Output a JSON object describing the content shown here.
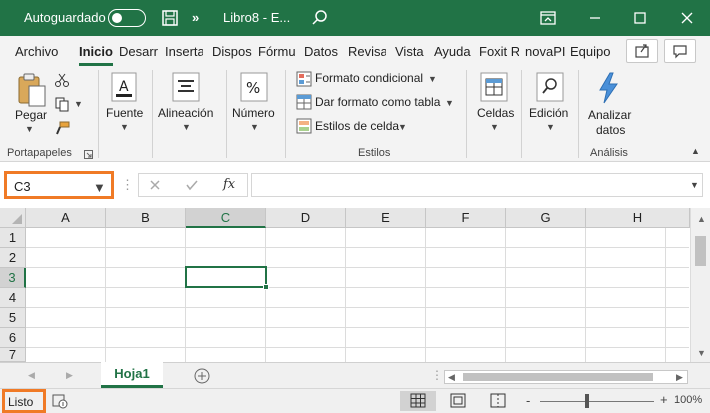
{
  "title_bar": {
    "autosave_label": "Autoguardado",
    "autosave_state": "off",
    "filename": "Libro8 - E...",
    "more_symbol": "»"
  },
  "ribbon_tabs": [
    "Archivo",
    "Inicio",
    "Desarr",
    "Insertar",
    "Dispos",
    "Fórmu",
    "Datos",
    "Revisar",
    "Vista",
    "Ayuda",
    "Foxit R",
    "novaPI",
    "Equipo"
  ],
  "active_tab": "Inicio",
  "ribbon": {
    "paste_label": "Pegar",
    "clipboard_group": "Portapapeles",
    "font_label": "Fuente",
    "align_label": "Alineación",
    "number_label": "Número",
    "conditional_format": "Formato condicional",
    "format_table": "Dar formato como tabla",
    "cell_styles": "Estilos de celda",
    "styles_group": "Estilos",
    "cells_label": "Celdas",
    "edit_label": "Edición",
    "analyze_label_1": "Analizar",
    "analyze_label_2": "datos",
    "analysis_group": "Análisis"
  },
  "formula_bar": {
    "name_box": "C3",
    "fx": "fx",
    "formula_value": ""
  },
  "grid": {
    "columns": [
      "A",
      "B",
      "C",
      "D",
      "E",
      "F",
      "G",
      "H"
    ],
    "rows": [
      "1",
      "2",
      "3",
      "4",
      "5",
      "6",
      "7"
    ],
    "active_column": "C",
    "active_row": "3"
  },
  "sheets": {
    "active": "Hoja1",
    "add_symbol": "+"
  },
  "status": {
    "ready": "Listo",
    "zoom": "100%",
    "zoom_minus": "-",
    "zoom_plus": "+"
  },
  "colors": {
    "accent": "#217346",
    "highlight": "#f07a26"
  }
}
